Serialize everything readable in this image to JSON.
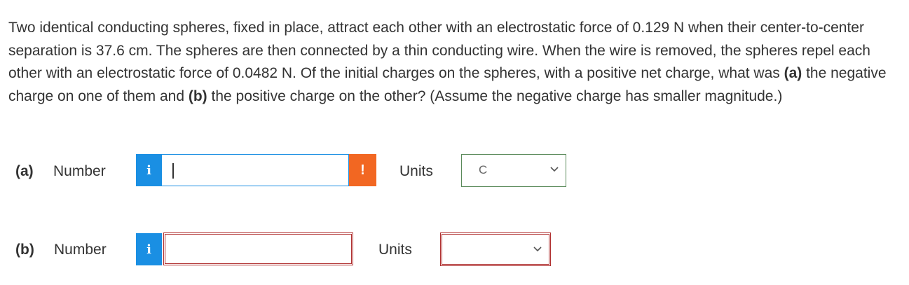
{
  "question": {
    "pre": "Two identical conducting spheres, fixed in place, attract each other with an electrostatic force of 0.129 N when their center-to-center separation is 37.6 cm. The spheres are then connected by a thin conducting wire. When the wire is removed, the spheres repel each other with an electrostatic force of 0.0482 N. Of the initial charges on the spheres, with a positive net charge, what was ",
    "part_a_marker": "(a)",
    "mid": " the negative charge on one of them and ",
    "part_b_marker": "(b)",
    "post": " the positive charge on the other? (Assume the negative charge has smaller magnitude.)"
  },
  "part_a": {
    "label": "(a)",
    "number_label": "Number",
    "info_icon": "i",
    "input_value": "",
    "warning_icon": "!",
    "units_label": "Units",
    "units_selected": "C"
  },
  "part_b": {
    "label": "(b)",
    "number_label": "Number",
    "info_icon": "i",
    "input_value": "",
    "units_label": "Units",
    "units_selected": ""
  },
  "colors": {
    "info": "#1a8fe3",
    "warning": "#f26722",
    "error_border": "#b03030",
    "valid_border": "#5a8a5a"
  }
}
